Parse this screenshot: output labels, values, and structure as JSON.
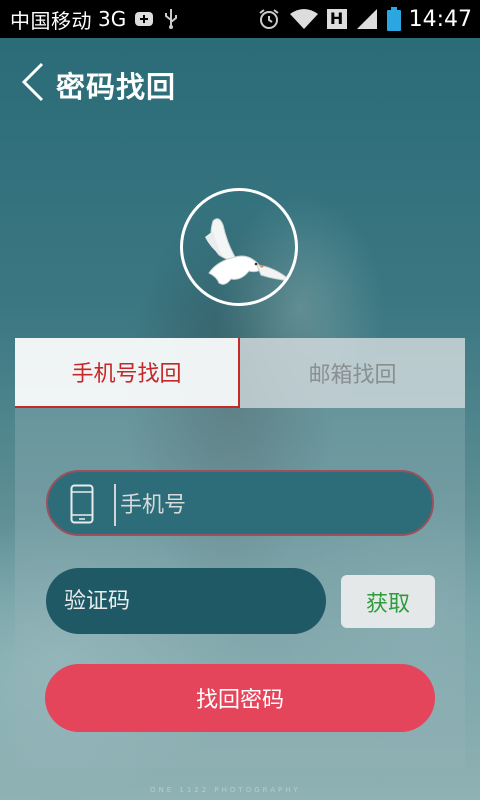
{
  "status_bar": {
    "carrier": "中国移动",
    "network": "3G",
    "time": "14:47",
    "icons": [
      "notification-plus-icon",
      "usb-icon",
      "alarm-icon",
      "wifi-icon",
      "h-signal-icon",
      "cell-signal-icon",
      "battery-icon"
    ],
    "h_badge": "H"
  },
  "header": {
    "title": "密码找回",
    "back_icon": "chevron-left-icon"
  },
  "logo": {
    "icon": "dove-icon"
  },
  "tabs": [
    {
      "label": "手机号找回",
      "active": true
    },
    {
      "label": "邮箱找回",
      "active": false
    }
  ],
  "form": {
    "phone": {
      "icon": "mobile-phone-icon",
      "value": "",
      "placeholder": "手机号"
    },
    "code": {
      "value": "",
      "placeholder": "验证码"
    },
    "get_code_label": "获取",
    "submit_label": "找回密码"
  },
  "watermark": "ONE 1122 PHOTOGRAPHY",
  "colors": {
    "accent_red": "#c62828",
    "submit_red": "#e5455b",
    "get_code_green": "#2e9b3c"
  }
}
